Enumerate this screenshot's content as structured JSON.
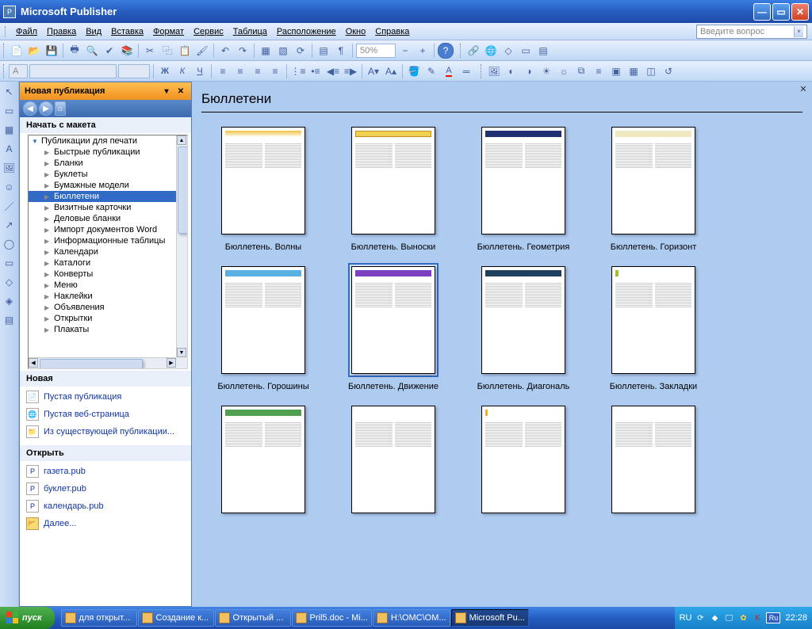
{
  "titlebar": {
    "app": "Microsoft Publisher"
  },
  "menu": {
    "file": "Файл",
    "edit": "Правка",
    "view": "Вид",
    "insert": "Вставка",
    "format": "Формат",
    "tools": "Сервис",
    "table": "Таблица",
    "arrange": "Расположение",
    "window": "Окно",
    "help": "Справка",
    "askbox": "Введите вопрос"
  },
  "toolbar": {
    "zoom": "50%",
    "font": "",
    "fontsize": ""
  },
  "taskpane": {
    "title": "Новая публикация",
    "section_start": "Начать с макета",
    "root": "Публикации для печати",
    "items": [
      "Быстрые публикации",
      "Бланки",
      "Буклеты",
      "Бумажные модели",
      "Бюллетени",
      "Визитные карточки",
      "Деловые бланки",
      "Импорт документов Word",
      "Информационные таблицы",
      "Календари",
      "Каталоги",
      "Конверты",
      "Меню",
      "Наклейки",
      "Объявления",
      "Открытки",
      "Плакаты"
    ],
    "selected_index": 4,
    "section_new": "Новая",
    "new_links": [
      "Пустая публикация",
      "Пустая веб-страница",
      "Из существующей публикации..."
    ],
    "section_open": "Открыть",
    "open_links": [
      "газета.pub",
      "буклет.pub",
      "календарь.pub",
      "Далее..."
    ]
  },
  "gallery": {
    "heading": "Бюллетени",
    "items": [
      "Бюллетень. Волны",
      "Бюллетень. Выноски",
      "Бюллетень. Геометрия",
      "Бюллетень. Горизонт",
      "Бюллетень. Горошины",
      "Бюллетень. Движение",
      "Бюллетень. Диагональ",
      "Бюллетень. Закладки",
      "",
      "",
      "",
      ""
    ],
    "selected_index": 5
  },
  "taskbar": {
    "start": "пуск",
    "tasks": [
      "для открыт...",
      "Создание к...",
      "Открытый ...",
      "Pril5.doc - Mi...",
      "H:\\OMC\\OM...",
      "Microsoft Pu..."
    ],
    "active_index": 5,
    "lang1": "RU",
    "lang2": "Ru",
    "clock": "22:28"
  }
}
